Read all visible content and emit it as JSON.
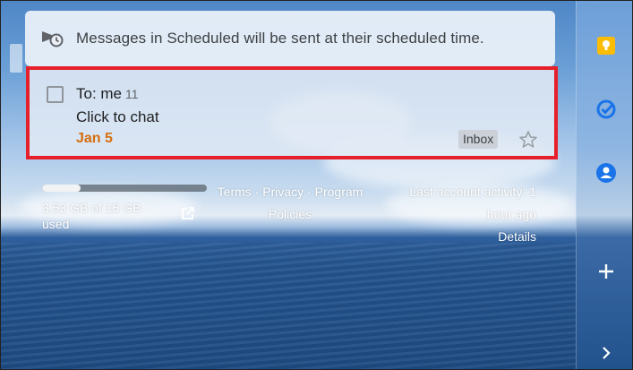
{
  "notice": {
    "text": "Messages in Scheduled will be sent at their scheduled time."
  },
  "message": {
    "recipient": "To: me",
    "count": "11",
    "subject": "Click to chat",
    "date": "Jan 5",
    "label": "Inbox"
  },
  "footer": {
    "storage_text": "3.53 GB of 15 GB used",
    "storage_fraction": 0.235,
    "links": [
      "Terms",
      "Privacy",
      "Program Policies"
    ],
    "activity_text": "Last account activity: 1 hour ago",
    "details_label": "Details"
  },
  "colors": {
    "highlight_border": "#e6202a",
    "date_color": "#d56e0c",
    "keep_yellow": "#fbbc04",
    "tasks_blue": "#1a73e8",
    "contacts_blue": "#1a73e8"
  },
  "side_panel": {
    "icons": [
      "keep-icon",
      "tasks-icon",
      "contacts-icon",
      "add-icon",
      "expand-panel-icon"
    ]
  }
}
